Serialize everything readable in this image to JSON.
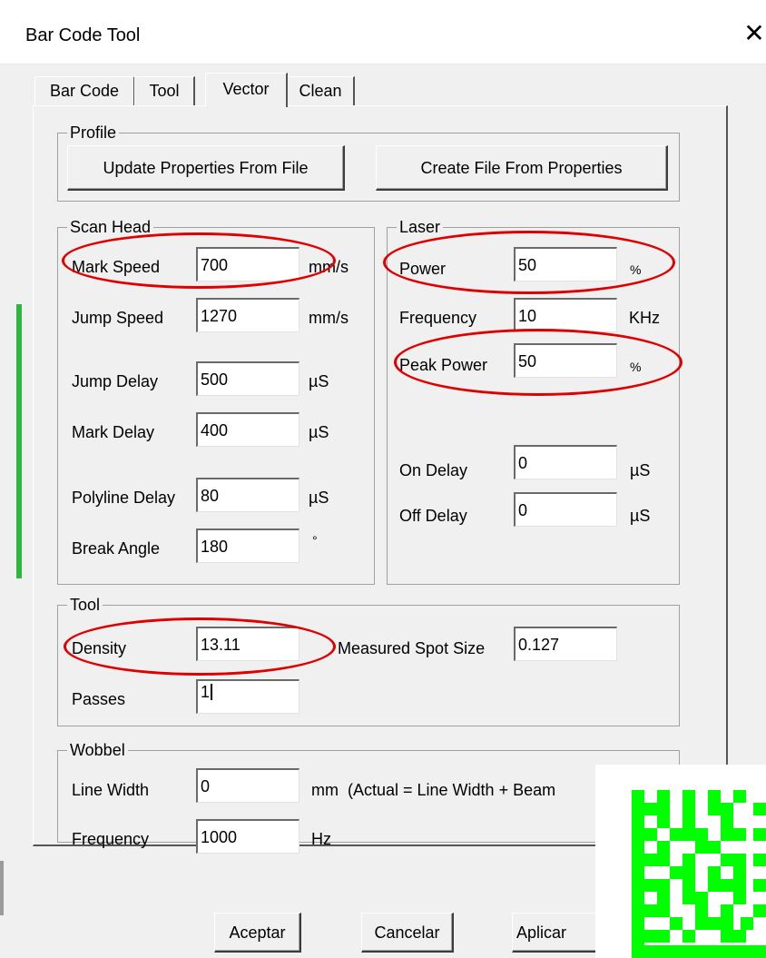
{
  "window": {
    "title": "Bar Code Tool",
    "close_glyph": "✕"
  },
  "tabs": [
    {
      "label": "Bar Code",
      "active": false
    },
    {
      "label": "Tool",
      "active": false
    },
    {
      "label": "Vector",
      "active": true
    },
    {
      "label": "Clean",
      "active": false
    }
  ],
  "profile": {
    "title": "Profile",
    "update_label": "Update Properties From File",
    "create_label": "Create File From Properties"
  },
  "scan_head": {
    "title": "Scan Head",
    "mark_speed": {
      "label": "Mark Speed",
      "value": "700",
      "unit": "mm/s"
    },
    "jump_speed": {
      "label": "Jump Speed",
      "value": "1270",
      "unit": "mm/s"
    },
    "jump_delay": {
      "label": "Jump Delay",
      "value": "500",
      "unit": "µS"
    },
    "mark_delay": {
      "label": "Mark Delay",
      "value": "400",
      "unit": "µS"
    },
    "polyline_delay": {
      "label": "Polyline Delay",
      "value": "80",
      "unit": "µS"
    },
    "break_angle": {
      "label": "Break Angle",
      "value": "180",
      "unit": "°"
    }
  },
  "laser": {
    "title": "Laser",
    "power": {
      "label": "Power",
      "value": "50",
      "unit": "%"
    },
    "frequency": {
      "label": "Frequency",
      "value": "10",
      "unit": "KHz"
    },
    "peak_power": {
      "label": "Peak Power",
      "value": "50",
      "unit": "%"
    },
    "on_delay": {
      "label": "On Delay",
      "value": "0",
      "unit": "µS"
    },
    "off_delay": {
      "label": "Off Delay",
      "value": "0",
      "unit": "µS"
    }
  },
  "tool": {
    "title": "Tool",
    "density": {
      "label": "Density",
      "value": "13.11"
    },
    "measured_spot": {
      "label": "Measured Spot Size",
      "value": "0.127"
    },
    "passes": {
      "label": "Passes",
      "value": "1"
    }
  },
  "wobbel": {
    "title": "Wobbel",
    "line_width": {
      "label": "Line Width",
      "value": "0",
      "unit": "mm  (Actual = Line Width + Beam"
    },
    "frequency": {
      "label": "Frequency",
      "value": "1000",
      "unit": "Hz"
    }
  },
  "footer": {
    "accept_label": "Aceptar",
    "cancel_label": "Cancelar",
    "apply_label": "Aplicar"
  },
  "colors": {
    "annotation_red": "#e00000",
    "barcode_green": "#00ff00",
    "dialog_bg": "#f0f0f0"
  },
  "icons": {
    "close": "close-icon",
    "barcode": "datamatrix-barcode-image"
  }
}
